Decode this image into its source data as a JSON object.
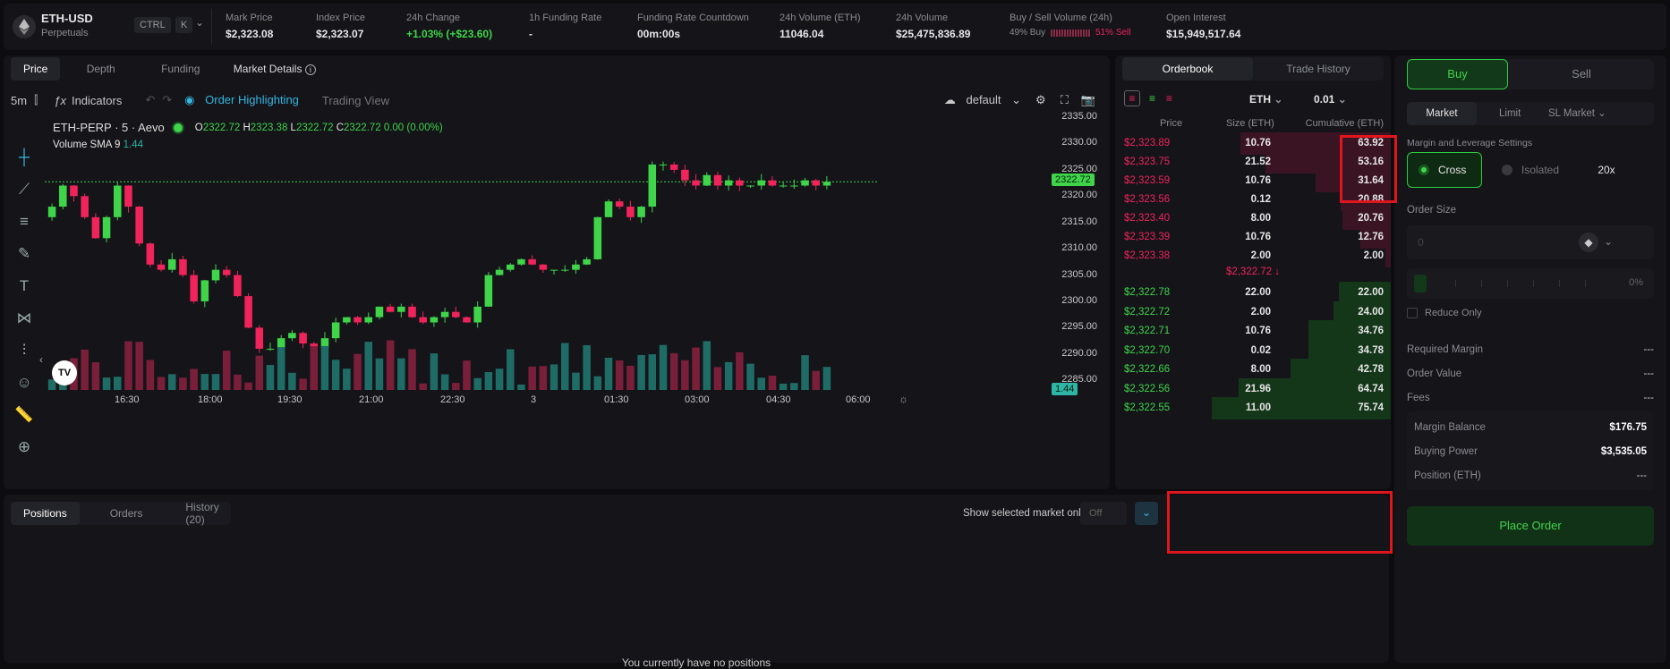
{
  "market": {
    "symbol": "ETH-USD",
    "type": "Perpetuals",
    "ctrl": "CTRL",
    "k": "K"
  },
  "stats": [
    {
      "label": "Mark Price",
      "value": "$2,323.08"
    },
    {
      "label": "Index Price",
      "value": "$2,323.07"
    },
    {
      "label": "24h Change",
      "value": "+1.03% (+$23.60)"
    },
    {
      "label": "1h Funding Rate",
      "value": "-"
    },
    {
      "label": "Funding Rate Countdown",
      "value": "00m:00s"
    },
    {
      "label": "24h Volume (ETH)",
      "value": "11046.04"
    },
    {
      "label": "24h Volume",
      "value": "$25,475,836.89"
    },
    {
      "label": "Buy / Sell Volume (24h)",
      "buy": "49% Buy",
      "sell": "51% Sell"
    },
    {
      "label": "Open Interest",
      "value": "$15,949,517.64"
    }
  ],
  "chart_tabs": [
    "Price",
    "Depth",
    "Funding",
    "Market Details"
  ],
  "toolbar": {
    "interval": "5m",
    "indicators": "Indicators",
    "highlight": "Order Highlighting",
    "view": "Trading View",
    "layout": "default"
  },
  "legend": {
    "title": "ETH-PERP · 5 · Aevo",
    "o": "2322.72",
    "h": "2323.38",
    "l": "2322.72",
    "c": "2322.72",
    "chg": "0.00 (0.00%)",
    "vol_label": "Volume SMA 9",
    "vol_val": "1.44"
  },
  "chart_data": {
    "type": "candlestick",
    "title": "ETH-PERP · 5 · Aevo",
    "y_ticks": [
      "2335.00",
      "2330.00",
      "2325.00",
      "2320.00",
      "2315.00",
      "2310.00",
      "2305.00",
      "2300.00",
      "2295.00",
      "2290.00",
      "2285.00"
    ],
    "x_ticks": [
      "16:30",
      "18:00",
      "19:30",
      "21:00",
      "22:30",
      "3",
      "01:30",
      "03:00",
      "04:30",
      "06:00"
    ],
    "last_price": "2322.72",
    "last_volume": "1.44",
    "close_series": [
      2318,
      2322,
      2320,
      2316,
      2312,
      2316,
      2322,
      2318,
      2311,
      2307,
      2306,
      2308,
      2305,
      2300,
      2304,
      2306,
      2305,
      2301,
      2295,
      2291,
      2291,
      2293,
      2294,
      2292,
      2291,
      2293,
      2296,
      2297,
      2296,
      2297,
      2299,
      2298,
      2299,
      2297,
      2296,
      2297,
      2298,
      2297,
      2296,
      2299,
      2305,
      2306,
      2307,
      2308,
      2307,
      2306,
      2306,
      2306,
      2307,
      2308,
      2316,
      2319,
      2318,
      2316,
      2318,
      2326,
      2326,
      2325,
      2323,
      2322,
      2324,
      2322,
      2323,
      2322,
      2322,
      2323,
      2322,
      2322,
      2322,
      2323,
      2322,
      2322.72
    ]
  },
  "ob_tabs": [
    "Orderbook",
    "Trade History"
  ],
  "ob_ctrl": {
    "asset": "ETH",
    "tick": "0.01"
  },
  "ob_headers": [
    "Price",
    "Size (ETH)",
    "Cumulative (ETH)"
  ],
  "asks": [
    {
      "price": "$2,323.89",
      "size": "10.76",
      "cum": "63.92",
      "depth": 0.84
    },
    {
      "price": "$2,323.75",
      "size": "21.52",
      "cum": "53.16",
      "depth": 0.7
    },
    {
      "price": "$2,323.59",
      "size": "10.76",
      "cum": "31.64",
      "depth": 0.42
    },
    {
      "price": "$2,323.56",
      "size": "0.12",
      "cum": "20.88",
      "depth": 0.28
    },
    {
      "price": "$2,323.40",
      "size": "8.00",
      "cum": "20.76",
      "depth": 0.27
    },
    {
      "price": "$2,323.39",
      "size": "10.76",
      "cum": "12.76",
      "depth": 0.17
    },
    {
      "price": "$2,323.38",
      "size": "2.00",
      "cum": "2.00",
      "depth": 0.03
    }
  ],
  "mid": "$2,322.72 ↓",
  "bids": [
    {
      "price": "$2,322.78",
      "size": "22.00",
      "cum": "22.00",
      "depth": 0.29
    },
    {
      "price": "$2,322.72",
      "size": "2.00",
      "cum": "24.00",
      "depth": 0.32
    },
    {
      "price": "$2,322.71",
      "size": "10.76",
      "cum": "34.76",
      "depth": 0.46
    },
    {
      "price": "$2,322.70",
      "size": "0.02",
      "cum": "34.78",
      "depth": 0.46
    },
    {
      "price": "$2,322.66",
      "size": "8.00",
      "cum": "42.78",
      "depth": 0.56
    },
    {
      "price": "$2,322.56",
      "size": "21.96",
      "cum": "64.74",
      "depth": 0.85
    },
    {
      "price": "$2,322.55",
      "size": "11.00",
      "cum": "75.74",
      "depth": 1.0
    }
  ],
  "pos_tabs": [
    "Positions",
    "Orders",
    "History (20)"
  ],
  "pos_filter": {
    "label": "Show selected market only",
    "value": "Off"
  },
  "pos_empty": "You currently have no positions",
  "order": {
    "buy": "Buy",
    "sell": "Sell",
    "types": [
      "Market",
      "Limit",
      "SL Market"
    ],
    "margin_label": "Margin and Leverage Settings",
    "cross": "Cross",
    "isolated": "Isolated",
    "leverage": "20x",
    "size_label": "Order Size",
    "size_placeholder": "0",
    "pct": "0%",
    "reduce": "Reduce Only",
    "req_margin": "Required Margin",
    "order_value": "Order Value",
    "fees": "Fees",
    "dash": "---",
    "margin_balance": "Margin Balance",
    "margin_balance_v": "$176.75",
    "buying_power": "Buying Power",
    "buying_power_v": "$3,535.05",
    "position": "Position (ETH)",
    "position_v": "---",
    "place": "Place Order"
  },
  "colors": {
    "up": "#3fd44a",
    "down": "#f0245a",
    "accent": "#2ecc40"
  }
}
